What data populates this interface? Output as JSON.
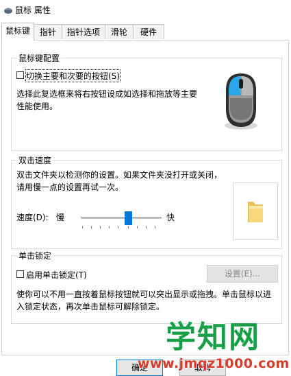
{
  "window": {
    "title": "鼠标 属性"
  },
  "tabs": [
    {
      "label": "鼠标键",
      "active": true
    },
    {
      "label": "指针",
      "active": false
    },
    {
      "label": "指针选项",
      "active": false
    },
    {
      "label": "滑轮",
      "active": false
    },
    {
      "label": "硬件",
      "active": false
    }
  ],
  "button_config": {
    "title": "鼠标键配置",
    "switch_label": "切换主要和次要的按钮(S)",
    "switch_checked": false,
    "description": "选择此复选框来将右按钮设成如选择和拖放等主要性能使用。"
  },
  "double_click": {
    "title": "双击速度",
    "description": "双击文件夹以检测你的设置。如果文件夹没打开或关闭，请用慢一点的设置再试一次。",
    "speed_label": "速度(D):",
    "slow_label": "慢",
    "fast_label": "快",
    "speed_level": 0.6
  },
  "click_lock": {
    "title": "单击锁定",
    "enable_label": "启用单击锁定(T)",
    "enable_checked": false,
    "settings_button": "设置(E)...",
    "description": "使你可以不用一直按着鼠标按钮就可以突出显示或拖拽。单击鼠标以进入锁定状态，再次单击鼠标可解除锁定。"
  },
  "footer": {
    "ok_label": "确定",
    "cancel_label": "取消"
  },
  "watermark": {
    "text": "学知网",
    "url": "www.jmqz1000.com"
  },
  "colors": {
    "accent": "#0078d7",
    "watermark_green": "#18a048",
    "watermark_red": "#d63a2a"
  }
}
